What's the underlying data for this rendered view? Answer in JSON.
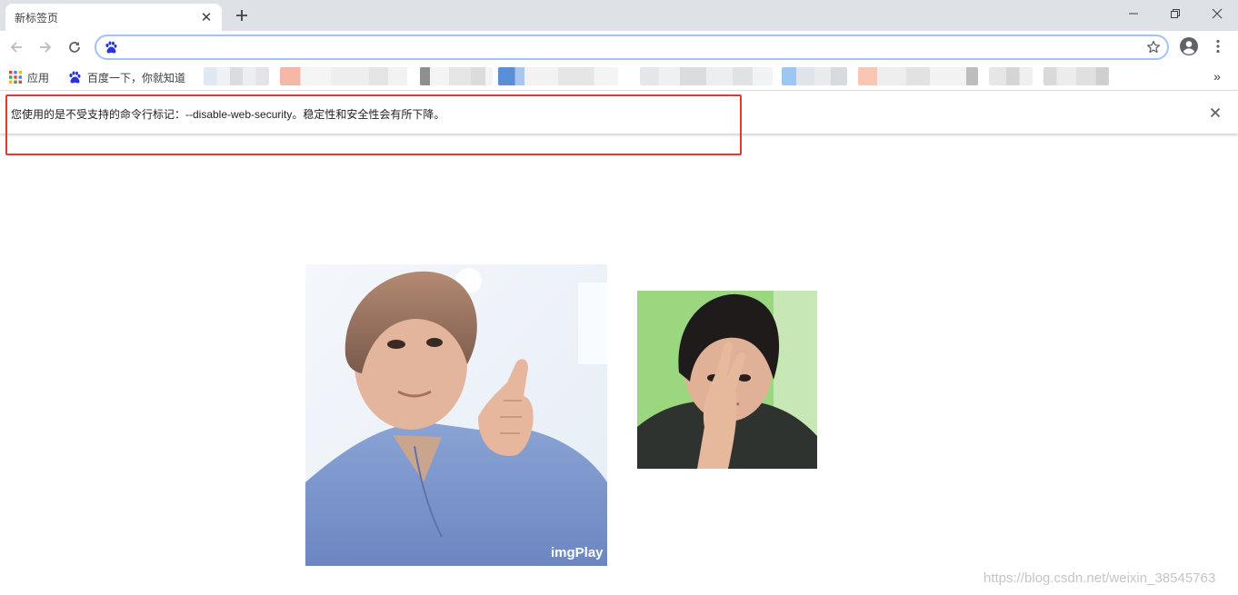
{
  "tab": {
    "title": "新标签页",
    "close_glyph": "✕",
    "new_tab_glyph": "+"
  },
  "window_controls": [
    "minimize-icon",
    "restore-icon",
    "close-icon"
  ],
  "toolbar": {
    "omnibox": {
      "value": "",
      "placeholder": "",
      "icon": "baidu-paw-icon"
    }
  },
  "bookmarks": {
    "apps_label": "应用",
    "baidu_label": "百度一下，你就知道",
    "more_glyph": "»"
  },
  "infobar": {
    "message": "您使用的是不受支持的命令行标记：--disable-web-security。稳定性和安全性会有所下降。",
    "close_glyph": "✕"
  },
  "content": {
    "photo1_caption": "imgPlay",
    "watermark": "https://blog.csdn.net/weixin_38545763"
  },
  "colors": {
    "tabstrip": "#dee1e6",
    "omnibox_border": "#a1c2fa",
    "highlight_border": "#e53935",
    "baidu_blue": "#2932e1"
  }
}
